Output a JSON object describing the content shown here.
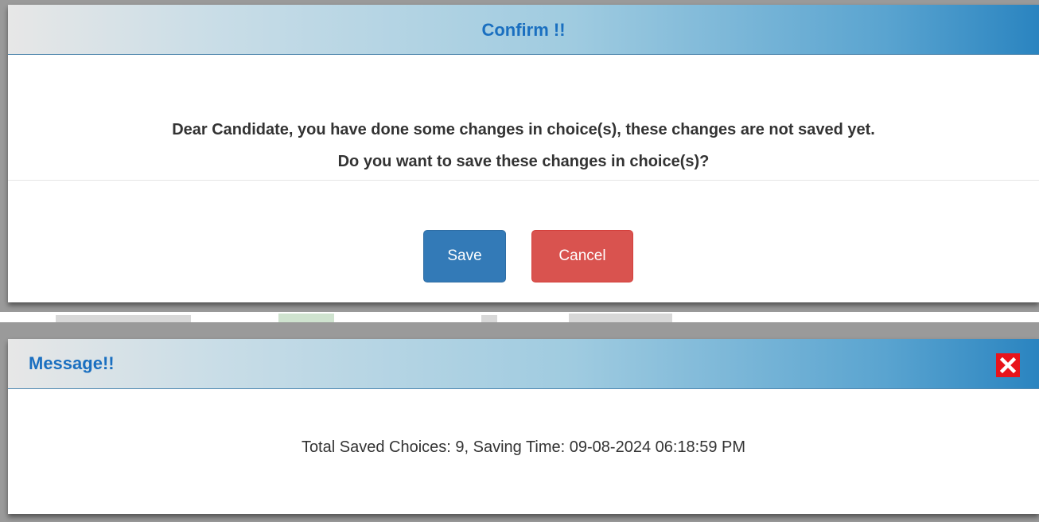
{
  "confirm_dialog": {
    "title": "Confirm !!",
    "message_line1": "Dear Candidate, you have done some changes in choice(s), these changes are not saved yet.",
    "message_line2": "Do you want to save these changes in choice(s)?",
    "save_label": "Save",
    "cancel_label": "Cancel"
  },
  "message_dialog": {
    "title": "Message!!",
    "body": "Total Saved Choices: 9, Saving Time: 09-08-2024 06:18:59 PM",
    "close_icon": "close-icon"
  },
  "colors": {
    "title_blue": "#1a6fc0",
    "save_button": "#337ab7",
    "cancel_button": "#d9534f",
    "close_button": "#e8141b"
  }
}
